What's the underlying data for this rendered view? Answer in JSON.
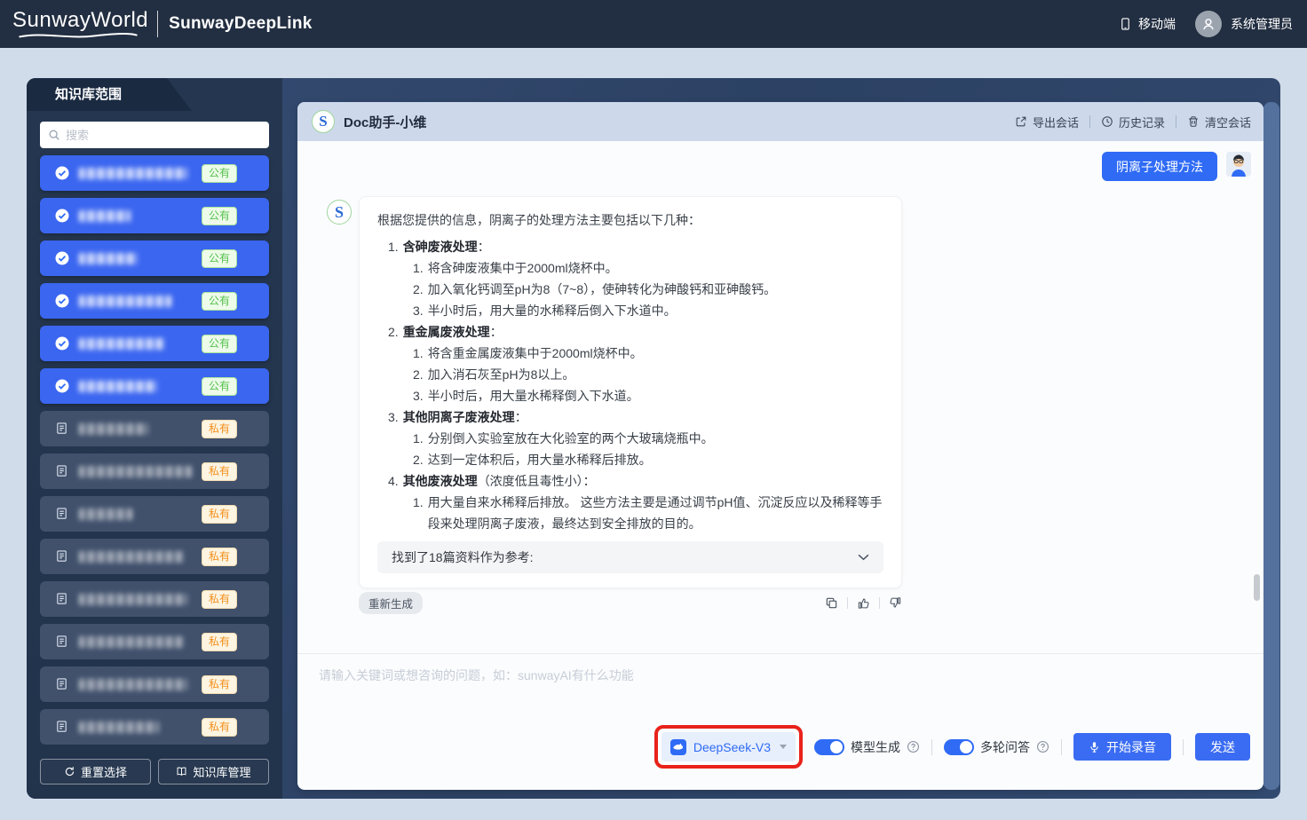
{
  "header": {
    "logo": "SunwayWorld",
    "product": "SunwayDeepLink",
    "mobile_label": "移动端",
    "user_label": "系统管理员"
  },
  "sidebar": {
    "title": "知识库范围",
    "search_placeholder": "搜索",
    "badge_public": "公有",
    "badge_private": "私有",
    "items": [
      {
        "access": "public",
        "blur_width": 122
      },
      {
        "access": "public",
        "blur_width": 58
      },
      {
        "access": "public",
        "blur_width": 66
      },
      {
        "access": "public",
        "blur_width": 104
      },
      {
        "access": "public",
        "blur_width": 96
      },
      {
        "access": "public",
        "blur_width": 88
      },
      {
        "access": "private",
        "blur_width": 78
      },
      {
        "access": "private",
        "blur_width": 128
      },
      {
        "access": "private",
        "blur_width": 60
      },
      {
        "access": "private",
        "blur_width": 118
      },
      {
        "access": "private",
        "blur_width": 122
      },
      {
        "access": "private",
        "blur_width": 118
      },
      {
        "access": "private",
        "blur_width": 122
      },
      {
        "access": "private",
        "blur_width": 90
      }
    ],
    "reset_button": "重置选择",
    "manage_button": "知识库管理"
  },
  "chat": {
    "logo_letter": "S",
    "title": "Doc助手-小维",
    "actions": {
      "export": "导出会话",
      "history": "历史记录",
      "clear": "清空会话"
    },
    "user_message": "阴离子处理方法",
    "assistant": {
      "intro": "根据您提供的信息，阴离子的处理方法主要包括以下几种：",
      "sections": [
        {
          "title": "含砷废液处理",
          "suffix": "：",
          "steps": [
            "将含砷废液集中于2000ml烧杯中。",
            "加入氧化钙调至pH为8（7~8），使砷转化为砷酸钙和亚砷酸钙。",
            "半小时后，用大量的水稀释后倒入下水道中。"
          ]
        },
        {
          "title": "重金属废液处理",
          "suffix": "：",
          "steps": [
            "将含重金属废液集中于2000ml烧杯中。",
            "加入消石灰至pH为8以上。",
            "半小时后，用大量水稀释倒入下水道。"
          ]
        },
        {
          "title": "其他阴离子废液处理",
          "suffix": "：",
          "steps": [
            "分别倒入实验室放在大化验室的两个大玻璃烧瓶中。",
            "达到一定体积后，用大量水稀释后排放。"
          ]
        },
        {
          "title": "其他废液处理",
          "suffix": "（浓度低且毒性小）：",
          "steps": [
            "用大量自来水稀释后排放。 这些方法主要是通过调节pH值、沉淀反应以及稀释等手段来处理阴离子废液，最终达到安全排放的目的。"
          ]
        }
      ],
      "reference": "找到了18篇资料作为参考:"
    },
    "regenerate": "重新生成",
    "input_placeholder": "请输入关键词或想咨询的问题，如：sunwayAI有什么功能",
    "model_selector": "DeepSeek-V3",
    "toggle_model_label": "模型生成",
    "toggle_model_on": true,
    "toggle_multi_label": "多轮问答",
    "toggle_multi_on": true,
    "record_button": "开始录音",
    "send_button": "发送"
  },
  "colors": {
    "accent_blue": "#2f6bf5",
    "selected_item_blue": "#3b66f0",
    "public_badge_green": "#57c24e",
    "private_badge_orange": "#f2901d",
    "annotation_red": "#e8221a",
    "topbar_bg": "#222e41",
    "container_bg": "#2e4467",
    "chat_header_bg": "#cdd9eb"
  }
}
